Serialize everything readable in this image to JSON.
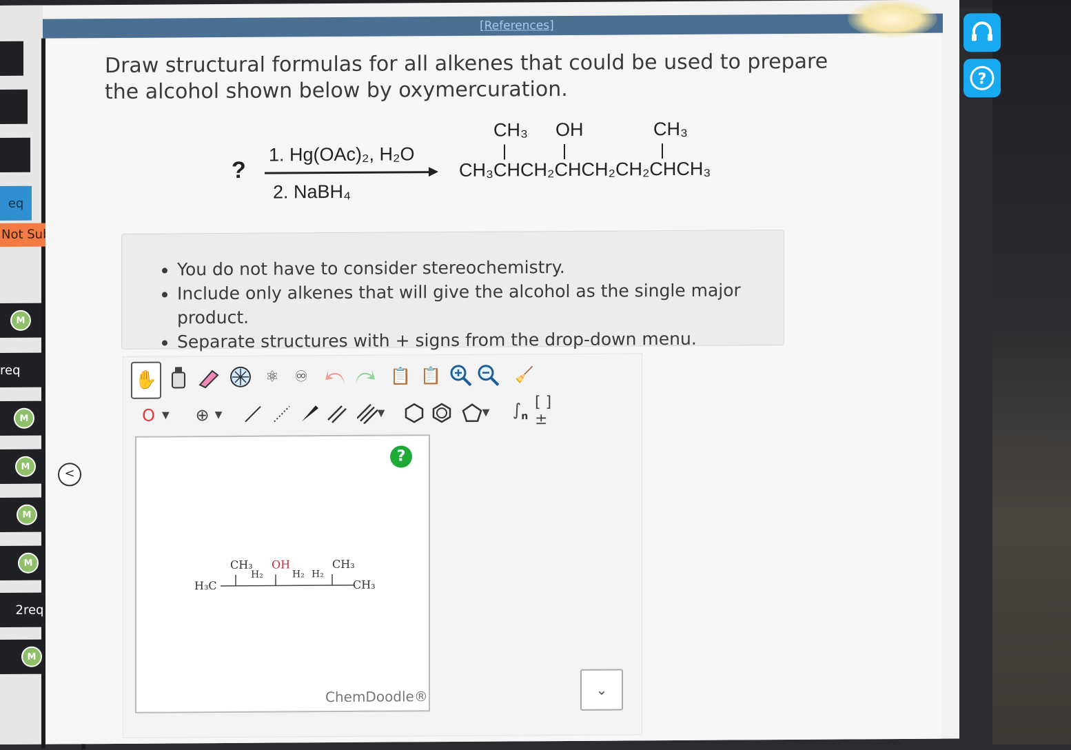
{
  "header": {
    "references_link": "[References]"
  },
  "question": {
    "text": "Draw structural formulas for all alkenes that could be used to prepare the alcohol shown below by oxymercuration."
  },
  "reaction": {
    "unknown": "?",
    "reagent_step1": "1. Hg(OAc)₂, H₂O",
    "reagent_step2": "2. NaBH₄",
    "product_top_left": "CH₃",
    "product_top_oh": "OH",
    "product_top_right": "CH₃",
    "product_chain": "CH₃CHCH₂CHCH₂CH₂CHCH₃"
  },
  "instructions": [
    "You do not have to consider stereochemistry.",
    "Include only alkenes that will give the alcohol as the single major product.",
    "Separate structures with + signs from the drop-down menu."
  ],
  "sidebar": {
    "items": [
      {
        "label": "eq"
      },
      {
        "label": "Not Submitted"
      },
      {
        "label": "M"
      },
      {
        "label": "req"
      },
      {
        "label": "M"
      },
      {
        "label": "M"
      },
      {
        "label": "M"
      },
      {
        "label": "M"
      },
      {
        "label": "2req"
      },
      {
        "label": "M"
      }
    ],
    "collapse_label": "<"
  },
  "chemdoodle": {
    "atom_label": "O",
    "help_label": "?",
    "brand": "ChemDoodle®",
    "canvas_molecule": {
      "left": "H₃C",
      "top1": "CH₃",
      "top2": "OH",
      "top3": "CH₃",
      "h2_a": "H₂",
      "h2_b": "H₂",
      "h2_c": "H₂",
      "right": "CH₃"
    },
    "sgroup_label": "[ ]±",
    "n_label": "n"
  },
  "dropdown": {
    "value": ""
  },
  "colors": {
    "accent": "#19a9f0",
    "status": "#f37a43",
    "badge": "#8fbf68",
    "help": "#1faa37"
  }
}
